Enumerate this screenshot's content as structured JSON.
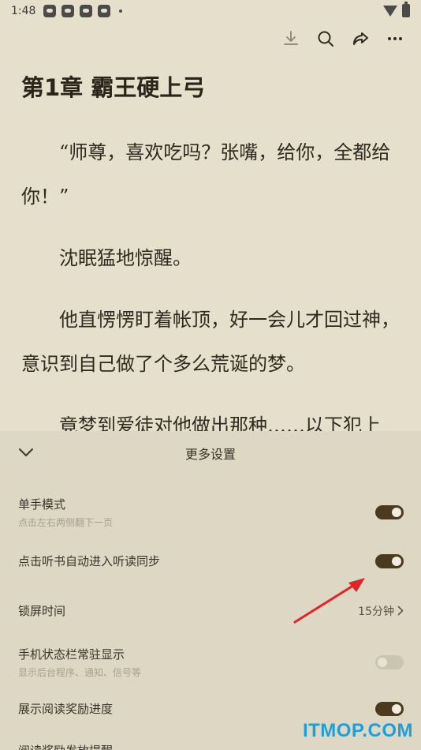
{
  "status": {
    "time": "1:48",
    "dot": "•"
  },
  "toolbar": {
    "icons": [
      "download-icon",
      "search-icon",
      "share-icon",
      "more-icon"
    ]
  },
  "chapter": {
    "title": "第1章 霸王硬上弓"
  },
  "paragraphs": [
    "“师尊，喜欢吃吗？张嘴，给你，全都给你！”",
    "沈眠猛地惊醒。",
    "他直愣愣盯着帐顶，好一会儿才回过神，意识到自己做了个多么荒诞的梦。",
    "竟梦到爱徒对他做出那种……以下犯上"
  ],
  "settings": {
    "title": "更多设置",
    "items": [
      {
        "label": "单手模式",
        "sub": "点击左右两侧翻下一页",
        "state": "on"
      },
      {
        "label": "点击听书自动进入听读同步",
        "state": "on"
      },
      {
        "label": "锁屏时间",
        "value": "15分钟"
      },
      {
        "label": "手机状态栏常驻显示",
        "sub": "显示后台程序、通知、信号等",
        "state": "off"
      },
      {
        "label": "展示阅读奖励进度",
        "state": "on"
      },
      {
        "label": "阅读奖励发放提醒"
      }
    ]
  },
  "colors": {
    "background": "#e5dfcb",
    "toggle_on": "#4c3a1f",
    "annotation": "#e0252a",
    "watermark": "#1f9fd9"
  },
  "watermark": "ITMOP.COM"
}
